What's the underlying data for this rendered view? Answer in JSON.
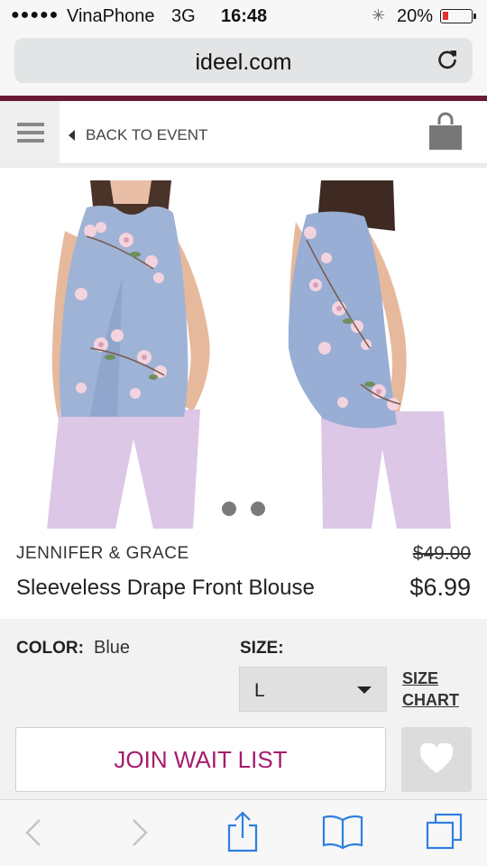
{
  "status_bar": {
    "signal": "●●●●●",
    "carrier": "VinaPhone",
    "network": "3G",
    "time": "16:48",
    "battery_pct": "20%",
    "battery_level": 0.2,
    "battery_color": "#e03030"
  },
  "browser": {
    "url": "ideel.com",
    "reload_icon": "reload-icon"
  },
  "header": {
    "menu_icon": "hamburger-icon",
    "back_label": "BACK TO EVENT",
    "bag_icon": "shopping-bag-icon"
  },
  "gallery": {
    "pages": 2,
    "current_page": 1
  },
  "product": {
    "brand": "JENNIFER & GRACE",
    "name": "Sleeveless Drape Front Blouse",
    "original_price": "$49.00",
    "sale_price": "$6.99"
  },
  "options": {
    "color_label": "COLOR:",
    "color_value": "Blue",
    "size_label": "SIZE:",
    "size_value": "L",
    "size_chart_line1": "SIZE",
    "size_chart_line2": "CHART",
    "join_label": "JOIN WAIT LIST",
    "join_color": "#a51d6d"
  },
  "colors": {
    "accent_line": "#6b1a35",
    "ios_blue": "#2f7fe0"
  }
}
